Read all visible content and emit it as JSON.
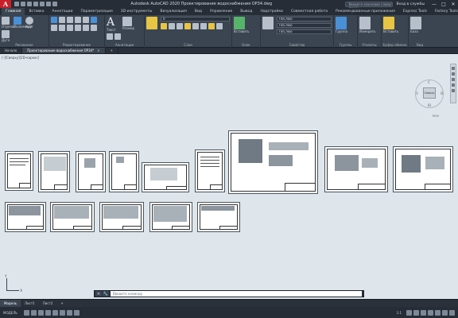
{
  "window": {
    "title": "Autodesk AutoCAD 2020   Проектирование водоснабжения ОР34.dwg",
    "search_placeholder": "Введите ключевое слово/фразу",
    "user": "Вход в службы",
    "minimize": "—",
    "maximize": "□",
    "close": "✕"
  },
  "app_logo": "A",
  "ribbon_tabs": [
    "Главная",
    "Вставка",
    "Аннотации",
    "Параметризация",
    "3D-инструменты",
    "Визуализация",
    "Вид",
    "Управление",
    "Вывод",
    "Надстройки",
    "Совместная работа",
    "Рекомендованные приложения",
    "Express Tools",
    "Factory Tools"
  ],
  "ribbon_active_tab": 0,
  "ribbon_panels": {
    "draw": {
      "title": "Рисование",
      "labels": [
        "Отрезок",
        "Полилиния",
        "Круг",
        "Дуга"
      ]
    },
    "modify": {
      "title": "Редактирование"
    },
    "annotation": {
      "title": "Аннотации",
      "labels": [
        "Текст",
        "Размер"
      ]
    },
    "layers": {
      "title": "Слои",
      "combo": "0"
    },
    "block": {
      "title": "Блок",
      "labels": [
        "Вставить"
      ]
    },
    "properties": {
      "title": "Свойства",
      "combo1": "ПоСлою",
      "combo2": "ПоСлою",
      "combo3": "ПоСлою",
      "labels": [
        "Копировать свойства"
      ]
    },
    "groups": {
      "title": "Группы",
      "labels": [
        "Группа"
      ]
    },
    "utilities": {
      "title": "Утилиты",
      "labels": [
        "Измерить"
      ]
    },
    "clipboard": {
      "title": "Буфер обмена",
      "labels": [
        "Вставить"
      ]
    },
    "view": {
      "title": "Вид",
      "labels": [
        "База"
      ]
    }
  },
  "document_tabs": [
    {
      "label": "Начало",
      "active": false
    },
    {
      "label": "Проектирование водоснабжения ОР34*",
      "active": true
    }
  ],
  "new_tab": "+",
  "viewport_label": "[-][Сверху][2D-каркас]",
  "viewcube": {
    "face": "Сверху",
    "north": "С",
    "south": "Ю",
    "west": "З",
    "east": "В",
    "wcs": "МСК"
  },
  "ucs": {
    "x": "X",
    "y": "Y"
  },
  "command_line": {
    "placeholder": "Введите команду",
    "close": "✕",
    "settings": "🔧"
  },
  "layout_tabs": [
    {
      "label": "Модель",
      "active": true
    },
    {
      "label": "Лист1",
      "active": false
    },
    {
      "label": "Лист2",
      "active": false
    },
    {
      "label": "+",
      "active": false
    }
  ],
  "status": {
    "mode": "МОДЕЛЬ",
    "scale": "1:1"
  },
  "colors": {
    "app_red": "#c8202a",
    "ribbon_bg": "#3b4552",
    "canvas_bg": "#dfe6eb",
    "tool_yellow": "#e8c542",
    "tool_blue": "#4a90d6",
    "tool_green": "#57b36a",
    "tool_gray": "#b7c0ca"
  }
}
